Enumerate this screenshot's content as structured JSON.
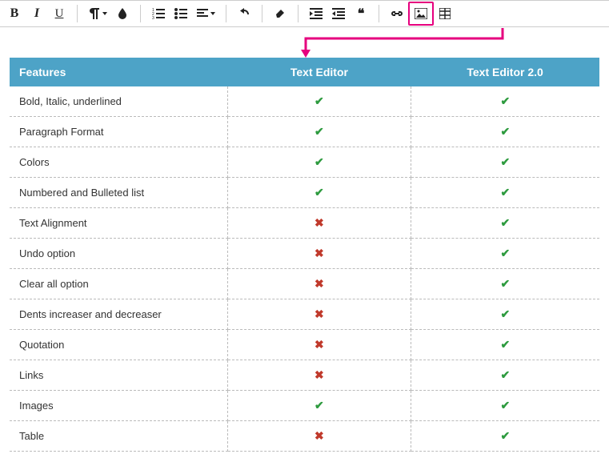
{
  "toolbar": {
    "bold": "B",
    "italic": "I",
    "underline": "U",
    "paragraph": "paragraph",
    "colors": "colors",
    "ol": "numbered-list",
    "ul": "bulleted-list",
    "align": "align",
    "undo": "undo",
    "clear": "clear",
    "indent": "indent",
    "outdent": "outdent",
    "quote": "quote",
    "link": "link",
    "image": "image",
    "table": "table"
  },
  "headers": {
    "features": "Features",
    "editor1": "Text Editor",
    "editor2": "Text Editor 2.0"
  },
  "rows": [
    {
      "label": "Bold, Italic, underlined",
      "c1": true,
      "c2": true
    },
    {
      "label": "Paragraph Format",
      "c1": true,
      "c2": true
    },
    {
      "label": "Colors",
      "c1": true,
      "c2": true
    },
    {
      "label": "Numbered and Bulleted list",
      "c1": true,
      "c2": true
    },
    {
      "label": "Text Alignment",
      "c1": false,
      "c2": true
    },
    {
      "label": "Undo option",
      "c1": false,
      "c2": true
    },
    {
      "label": "Clear all option",
      "c1": false,
      "c2": true
    },
    {
      "label": "Dents increaser and decreaser",
      "c1": false,
      "c2": true
    },
    {
      "label": "Quotation",
      "c1": false,
      "c2": true
    },
    {
      "label": " Links",
      "c1": false,
      "c2": true
    },
    {
      "label": "Images",
      "c1": true,
      "c2": true
    },
    {
      "label": "Table",
      "c1": false,
      "c2": true
    }
  ],
  "glyphs": {
    "yes": "✔",
    "no": "✖"
  },
  "colors": {
    "highlight": "#e6007e"
  }
}
